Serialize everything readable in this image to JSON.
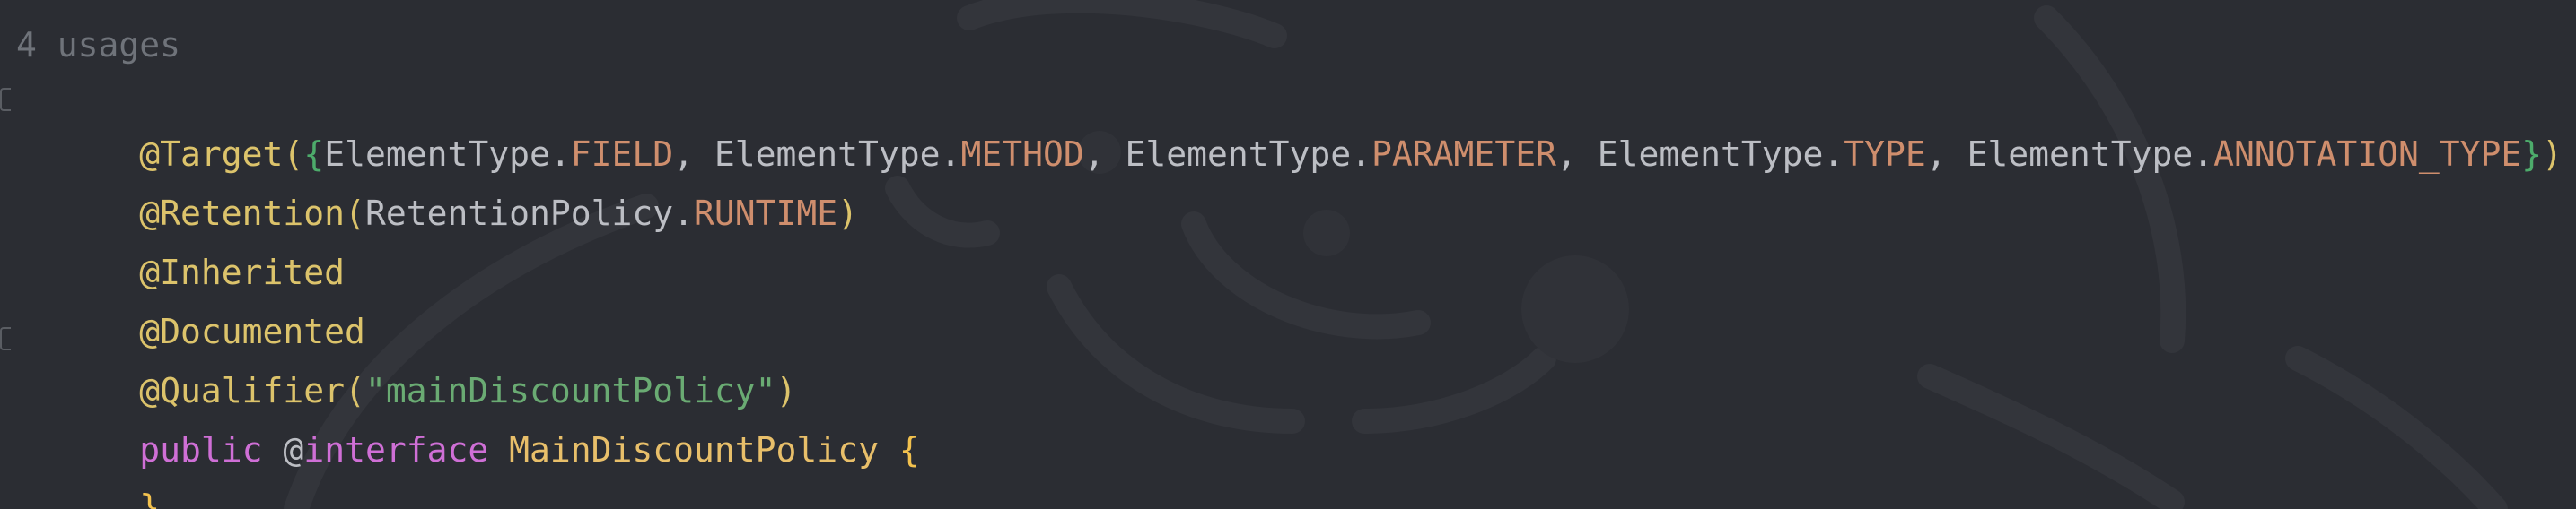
{
  "usages_hint": "4 usages",
  "line1": {
    "at": "@Target(",
    "open_brace": "{",
    "t1": "ElementType.",
    "c1": "FIELD",
    "sep1": ", ",
    "t2": "ElementType.",
    "c2": "METHOD",
    "sep2": ", ",
    "t3": "ElementType.",
    "c3": "PARAMETER",
    "sep3": ", ",
    "t4": "ElementType.",
    "c4": "TYPE",
    "sep4": ", ",
    "t5": "ElementType.",
    "c5": "ANNOTATION_TYPE",
    "close_brace": "}",
    "close_paren": ")"
  },
  "line2": {
    "at": "@Retention(",
    "t": "RetentionPolicy.",
    "c": "RUNTIME",
    "close_paren": ")"
  },
  "line3": {
    "at": "@Inherited"
  },
  "line4": {
    "at": "@Documented"
  },
  "line5": {
    "at": "@Qualifier(",
    "str": "\"mainDiscountPolicy\"",
    "close_paren": ")"
  },
  "line6": {
    "kw": "public",
    "sp1": " ",
    "at": "@",
    "kw2": "interface",
    "sp2": " ",
    "name": "MainDiscountPolicy",
    "sp3": " ",
    "brace": "{"
  },
  "line7": {
    "brace": "}"
  }
}
